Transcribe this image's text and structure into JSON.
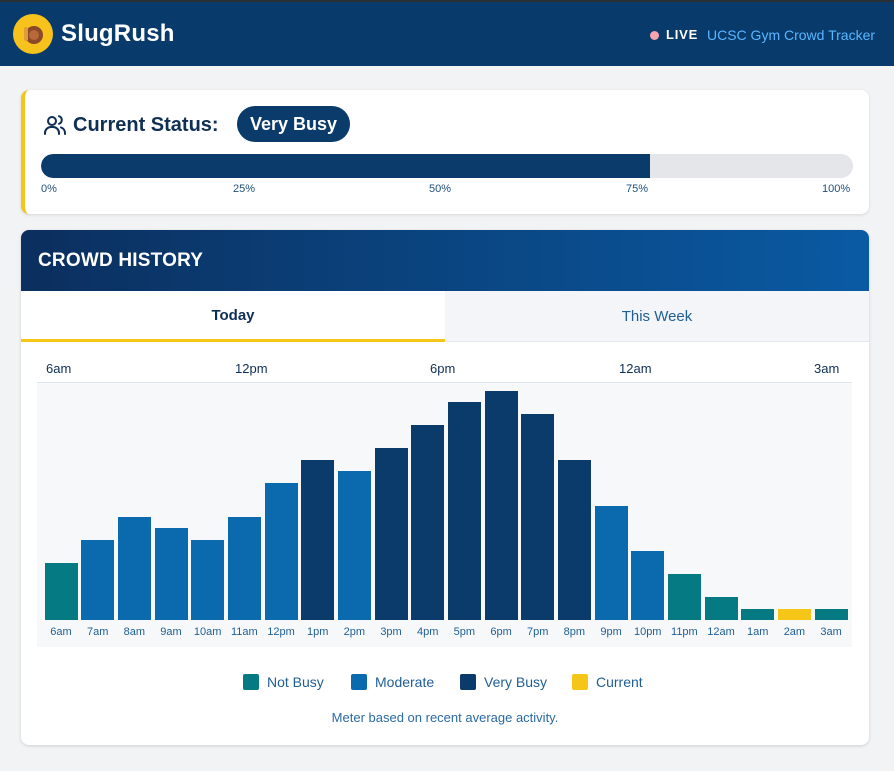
{
  "header": {
    "app_name": "SlugRush",
    "live_label": "LIVE",
    "tracker_link": "UCSC Gym Crowd Tracker",
    "logo_icon": "slug-logo-icon",
    "live_color": "#f5a3ae"
  },
  "status": {
    "label": "Current Status:",
    "value": "Very Busy",
    "icon": "users-icon",
    "meter_percent": 75,
    "ticks": [
      "0%",
      "25%",
      "50%",
      "75%",
      "100%"
    ]
  },
  "history": {
    "title": "CROWD HISTORY",
    "tabs": [
      {
        "label": "Today",
        "active": true
      },
      {
        "label": "This Week",
        "active": false
      }
    ],
    "top_axis": [
      "6am",
      "12pm",
      "6pm",
      "12am",
      "3am"
    ],
    "legend": [
      {
        "label": "Not Busy",
        "color": "#067a82"
      },
      {
        "label": "Moderate",
        "color": "#0b6aae"
      },
      {
        "label": "Very Busy",
        "color": "#0b3b6b"
      },
      {
        "label": "Current",
        "color": "#f5c518"
      }
    ],
    "footnote": "Meter based on recent average activity."
  },
  "chart_data": {
    "type": "bar",
    "categories": [
      "6am",
      "7am",
      "8am",
      "9am",
      "10am",
      "11am",
      "12pm",
      "1pm",
      "2pm",
      "3pm",
      "4pm",
      "5pm",
      "6pm",
      "7pm",
      "8pm",
      "9pm",
      "10pm",
      "11pm",
      "12am",
      "1am",
      "2am",
      "3am"
    ],
    "values": [
      25,
      35,
      45,
      40,
      35,
      45,
      60,
      70,
      65,
      75,
      85,
      95,
      100,
      90,
      70,
      50,
      30,
      20,
      10,
      5,
      5,
      5
    ],
    "levels": [
      "Not Busy",
      "Moderate",
      "Moderate",
      "Moderate",
      "Moderate",
      "Moderate",
      "Moderate",
      "Very Busy",
      "Moderate",
      "Very Busy",
      "Very Busy",
      "Very Busy",
      "Very Busy",
      "Very Busy",
      "Very Busy",
      "Moderate",
      "Moderate",
      "Not Busy",
      "Not Busy",
      "Not Busy",
      "Current",
      "Not Busy"
    ],
    "ylim": [
      0,
      100
    ],
    "title": "",
    "xlabel": "",
    "ylabel": ""
  }
}
